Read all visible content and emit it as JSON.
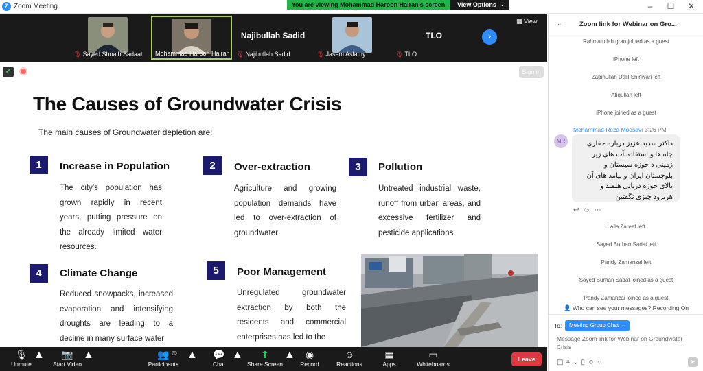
{
  "window": {
    "title": "Zoom Meeting",
    "logo": "Z",
    "minimize": "–",
    "maximize": "☐",
    "close": "✕"
  },
  "banner": {
    "text": "You are viewing Mohammad Haroon Hairan's screen",
    "options_label": "View Options",
    "options_chevron": "⌄"
  },
  "participants_strip": [
    {
      "name": "Sayed Shoaib Sadaat",
      "muted": true,
      "video": true
    },
    {
      "name": "Mohammad Haroon Hairan",
      "muted": false,
      "video": true,
      "active": true
    },
    {
      "name": "Najibullah Sadid",
      "big_name": "Najibullah Sadid",
      "muted": true,
      "video": false
    },
    {
      "name": "Jasem Aslamy",
      "muted": true,
      "video": true
    },
    {
      "name": "TLO",
      "big_name": "TLO",
      "muted": true,
      "video": false
    }
  ],
  "strip_controls": {
    "next": "›",
    "view_label": "View"
  },
  "share_overlay": {
    "signin": "Sign in"
  },
  "slide": {
    "title": "The Causes of Groundwater Crisis",
    "subtitle": "The main causes of Groundwater depletion are:",
    "causes": [
      {
        "n": "1",
        "heading": "Increase in Population",
        "text": "The city's population has grown rapidly in recent years, putting pressure on the already limited water resources."
      },
      {
        "n": "2",
        "heading": "Over-extraction",
        "text": "Agriculture and growing population demands have led to over-extraction of groundwater"
      },
      {
        "n": "3",
        "heading": "Pollution",
        "text": "Untreated industrial waste, runoff from urban areas, and excessive fertilizer and pesticide applications"
      },
      {
        "n": "4",
        "heading": "Climate Change",
        "text": "Reduced snowpacks, increased evaporation and intensifying droughts are leading to a decline in many surface water"
      },
      {
        "n": "5",
        "heading": "Poor Management",
        "text": "Unregulated groundwater extraction by both the residents and commercial enterprises has led to the"
      }
    ]
  },
  "toolbar": {
    "unmute": "Unmute",
    "start_video": "Start Video",
    "participants": "Participants",
    "participants_count": "75",
    "chat": "Chat",
    "share_screen": "Share Screen",
    "record": "Record",
    "reactions": "Reactions",
    "apps": "Apps",
    "whiteboards": "Whiteboards",
    "leave": "Leave"
  },
  "chat": {
    "title": "Zoom link for Webinar on Gro...",
    "system_top": [
      "Rahmatullah gran joined as a guest",
      "iPhone left",
      "Zabihullah Dalil Shinwari left",
      "Atiqullah left",
      "iPhone joined as a guest"
    ],
    "message": {
      "sender": "Mohammad Reza Moosavi",
      "time": "3:26 PM",
      "avatar": "MR",
      "lines": [
        "داکتر سدید عزیز درباره حفاری",
        "چاه ها و استفاده آب های زیر",
        "زمینی د حوزه سیستان و",
        "بلوچستان ایران و پیامد های آن",
        "بالای حوزه دریایی هلمند و",
        "هریرود چیزی نگفتین"
      ]
    },
    "system_bottom": [
      "Laila Zareef left",
      "Sayed Burhan Sadat left",
      "Pandy Zamanzai left",
      "Sayed Burhan Sadat joined as a guest",
      "Pandy Zamanzai joined as a guest"
    ],
    "who_can_see": "Who can see your messages? Recording On",
    "to_label": "To:",
    "to_value": "Meeting Group Chat",
    "input_placeholder": "Message Zoom link for Webinar on Groundwater Crisis"
  }
}
